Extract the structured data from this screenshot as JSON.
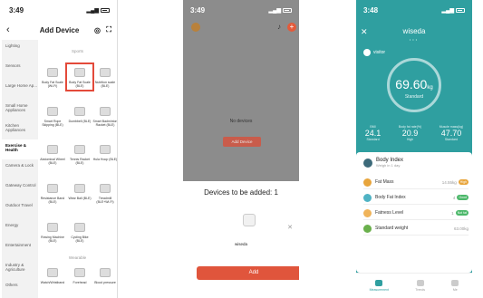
{
  "phone1": {
    "time": "3:49",
    "title": "Add Device",
    "categories": [
      "Lighting",
      "Sensors",
      "Large Home Ap...",
      "Small Home Appliances",
      "Kitchen Appliances",
      "Exercise & Health",
      "Camera & Lock",
      "Gateway Control",
      "Outdoor Travel",
      "Energy",
      "Entertainment",
      "Industry & Agriculture",
      "Others"
    ],
    "active_category": "Exercise & Health",
    "sections": [
      "Sports",
      "Wearable"
    ],
    "products": [
      {
        "name": "Body Fat Scale (Wi-Fi)",
        "icon": "scale-icon"
      },
      {
        "name": "Body Fat Scale (BLE)",
        "icon": "scale-icon"
      },
      {
        "name": "Nutrition scale (BLE)",
        "icon": "scale-icon"
      },
      {
        "name": "Smart Rope Skipping (BLE)",
        "icon": "rope-icon"
      },
      {
        "name": "Dumbbell (BLE)",
        "icon": "dumbbell-icon"
      },
      {
        "name": "Smart Badminton Racket (BLE)",
        "icon": "racket-icon"
      },
      {
        "name": "Abdominal Wheel (BLE)",
        "icon": "wheel-icon"
      },
      {
        "name": "Tennis Racket (BLE)",
        "icon": "racket-icon"
      },
      {
        "name": "Hula Hoop (BLE)",
        "icon": "hoop-icon"
      },
      {
        "name": "Resistance Band (BLE)",
        "icon": "band-icon"
      },
      {
        "name": "Wear Ball (BLE)",
        "icon": "ball-icon"
      },
      {
        "name": "Treadmill (BLE+Wi-Fi)",
        "icon": "treadmill-icon"
      },
      {
        "name": "Rowing Machine (BLE)",
        "icon": "rowing-icon"
      },
      {
        "name": "Cycling Bike (BLE)",
        "icon": "bike-icon"
      },
      {
        "name": "Watch/Wristband",
        "icon": "watch-icon"
      },
      {
        "name": "Forehead",
        "icon": "thermometer-icon"
      },
      {
        "name": "Blood pressure",
        "icon": "blood-pressure-icon"
      }
    ]
  },
  "phone2": {
    "time": "3:49",
    "no_devices": "No devices",
    "add_device_label": "Add Device",
    "sheet_title": "Devices to be added: 1",
    "device_name": "wiseda",
    "add_button": "Add"
  },
  "phone3": {
    "time": "3:48",
    "title": "wiseda",
    "user": "visitor",
    "weight": "69.60",
    "weight_unit": "kg",
    "weight_status": "Standard",
    "metrics": [
      {
        "label": "BMI",
        "value": "24.1",
        "status": "Standard"
      },
      {
        "label": "Body fat rate(%)",
        "value": "20.9",
        "status": "High"
      },
      {
        "label": "Muscle mass(kg)",
        "value": "47.70",
        "status": "Standard"
      }
    ],
    "body_index_title": "Body Index",
    "body_index_sub": "Weigh in 1 day",
    "rows": [
      {
        "name": "Fat Mass",
        "value": "14.55kg",
        "badge": "High",
        "color": "#e8a53c"
      },
      {
        "name": "Body Fat Index",
        "value": "4",
        "badge": "Good",
        "color": "#4cb86a"
      },
      {
        "name": "Fatness Level",
        "value": "1",
        "badge": "Not fat",
        "color": "#4cb86a"
      },
      {
        "name": "Standard weight",
        "value": "63.00kg",
        "badge": "",
        "color": "#cccccc"
      }
    ],
    "tabs": [
      "Measurement",
      "Trends",
      "Me"
    ],
    "accent": "#2f9fa0"
  }
}
